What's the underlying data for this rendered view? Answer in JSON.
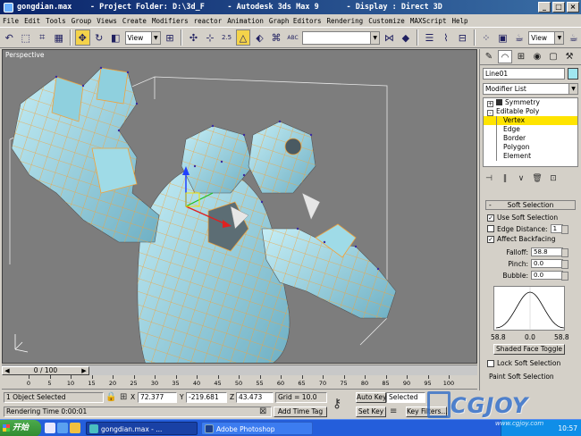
{
  "window": {
    "title": "gongdian.max    - Project Folder: D:\\3d_F     - Autodesk 3ds Max 9      - Display : Direct 3D",
    "minimize": "_",
    "maximize": "□",
    "close": "×"
  },
  "menu": [
    "File",
    "Edit",
    "Tools",
    "Group",
    "Views",
    "Create",
    "Modifiers",
    "reactor",
    "Animation",
    "Graph Editors",
    "Rendering",
    "Customize",
    "MAXScript",
    "Help"
  ],
  "toolbar": {
    "view_select": "View",
    "view_select_right": "View",
    "named_selection": "",
    "snap_value": "2.5",
    "icons": [
      "undo-icon",
      "redo-icon",
      "link-icon",
      "unlink-icon",
      "bind-icon",
      "select-icon",
      "select-region-icon",
      "select-name-icon",
      "window-crossing-icon",
      "move-icon",
      "rotate-icon",
      "scale-icon"
    ]
  },
  "viewport": {
    "label": "Perspective",
    "background": "#7d7d7d",
    "mesh_color": "#a9e0ec",
    "edge_color": "#f2a23a"
  },
  "command_panel": {
    "object_name": "Line01",
    "object_color": "#a0e6f0",
    "modifier_list": "Modifier List",
    "stack": [
      {
        "label": "Symmetry",
        "level": 0,
        "selected": false
      },
      {
        "label": "Editable Poly",
        "level": 0,
        "selected": false
      },
      {
        "label": "Vertex",
        "level": 1,
        "selected": true
      },
      {
        "label": "Edge",
        "level": 1,
        "selected": false
      },
      {
        "label": "Border",
        "level": 1,
        "selected": false
      },
      {
        "label": "Polygon",
        "level": 1,
        "selected": false
      },
      {
        "label": "Element",
        "level": 1,
        "selected": false
      }
    ],
    "soft_selection": {
      "title": "Soft Selection",
      "use_soft_selection": "Use Soft Selection",
      "edge_distance": "Edge Distance:",
      "edge_distance_value": "1",
      "affect_backfacing": "Affect Backfacing",
      "falloff_label": "Falloff:",
      "falloff_value": "58.8",
      "pinch_label": "Pinch:",
      "pinch_value": "0.0",
      "bubble_label": "Bubble:",
      "bubble_value": "0.0",
      "curve_left": "58.8",
      "curve_mid": "0.0",
      "curve_right": "58.8",
      "shaded_face_toggle": "Shaded Face Toggle",
      "lock_soft_selection": "Lock Soft Selection",
      "paint_soft_selection": "Paint Soft Selection"
    },
    "rollout_sign": "-"
  },
  "timeline": {
    "slider": "0 / 100",
    "ticks": [
      "0",
      "5",
      "10",
      "15",
      "20",
      "25",
      "30",
      "35",
      "40",
      "45",
      "50",
      "55",
      "60",
      "65",
      "70",
      "75",
      "80",
      "85",
      "90",
      "95",
      "100"
    ]
  },
  "status": {
    "selection": "1 Object Selected",
    "prompt": "Rendering Time  0:00:01",
    "x_label": "X",
    "x_value": "72.377",
    "y_label": "Y",
    "y_value": "-219.681",
    "z_label": "Z",
    "z_value": "43.473",
    "grid": "Grid = 10.0",
    "add_time_tag": "Add Time Tag",
    "auto_key": "Auto Key",
    "auto_key_mode": "Selected",
    "set_key": "Set Key",
    "key_filters": "Key Filters..."
  },
  "taskbar": {
    "start": "开始",
    "tasks": [
      {
        "label": "gongdian.max - ...",
        "active": true
      },
      {
        "label": "Adobe Photoshop",
        "active": false
      }
    ],
    "clock": "10:57"
  },
  "watermark": {
    "text": "CGJOY",
    "sub": "www.cgjoy.com"
  }
}
